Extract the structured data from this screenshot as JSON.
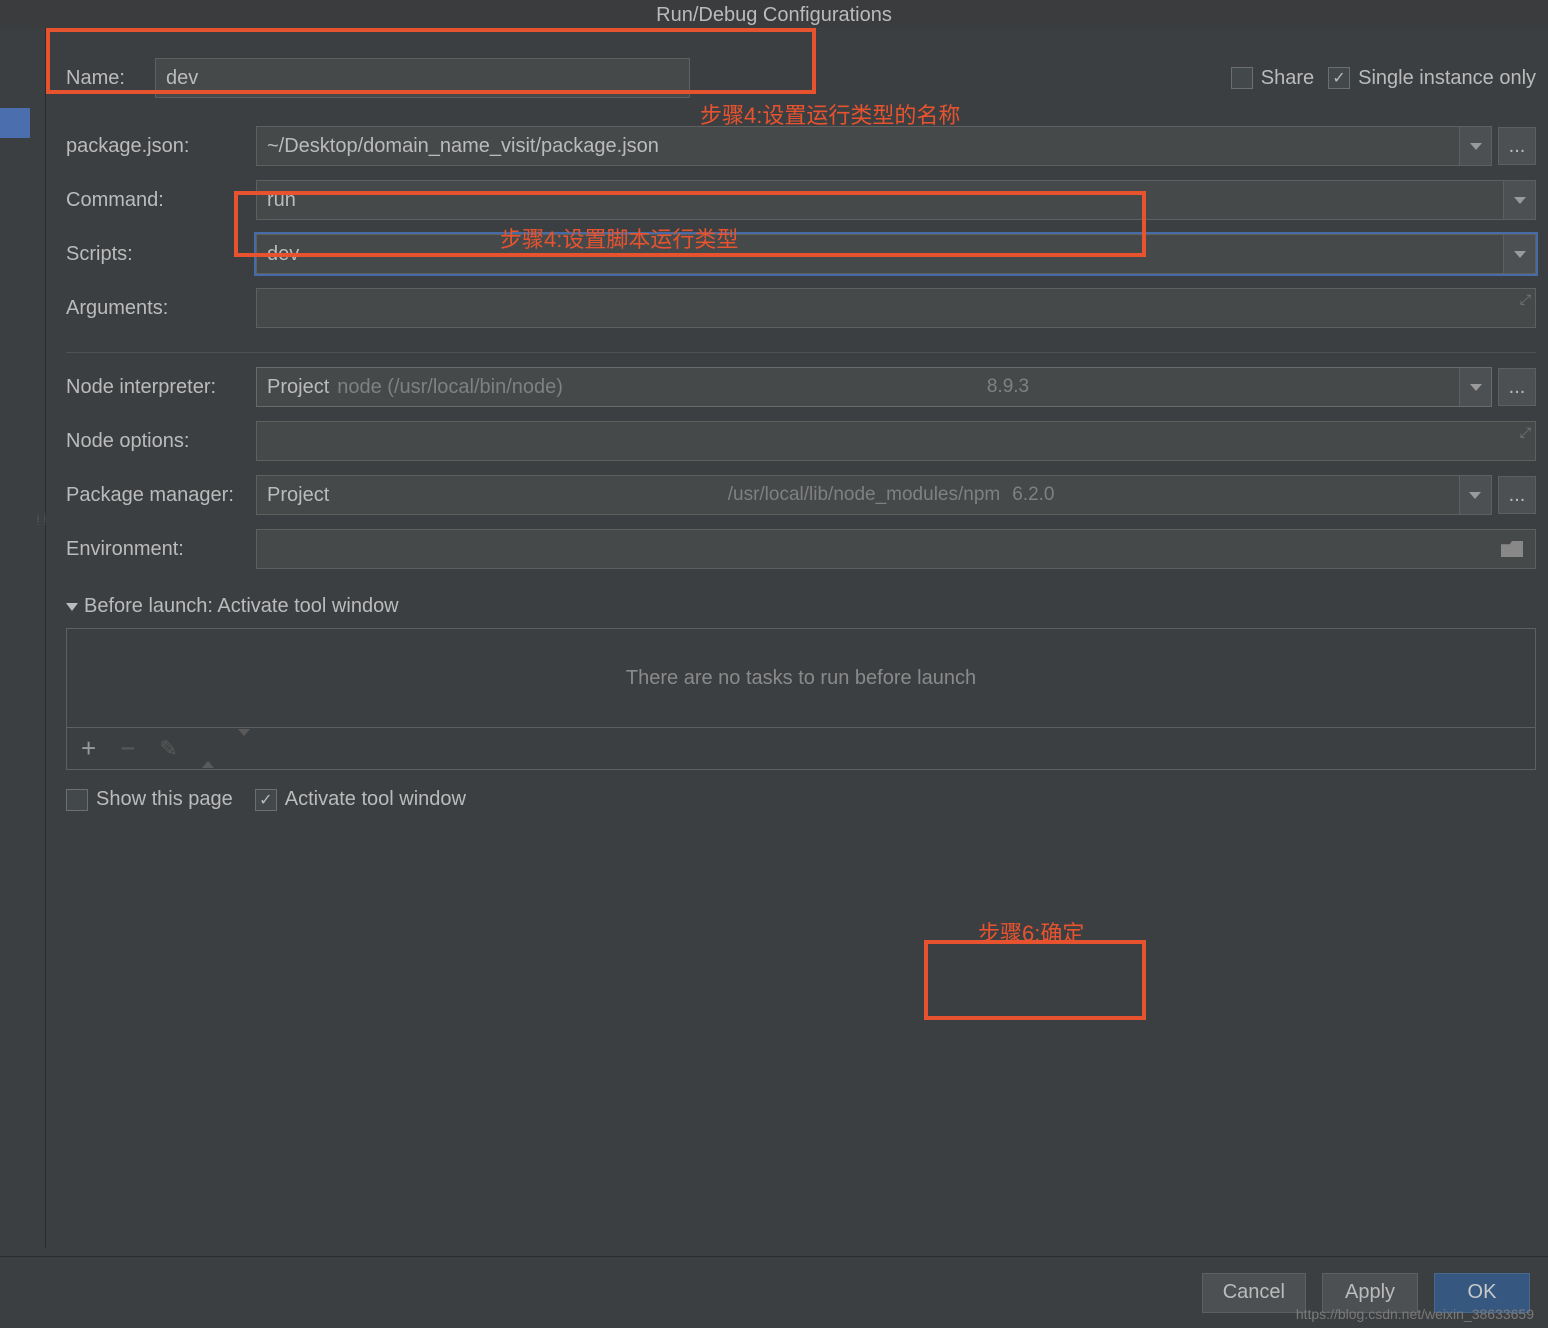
{
  "title": "Run/Debug Configurations",
  "form": {
    "name_label": "Name:",
    "name_value": "dev",
    "share_label": "Share",
    "single_instance_label": "Single instance only",
    "package_json_label": "package.json:",
    "package_json_value": "~/Desktop/domain_name_visit/package.json",
    "command_label": "Command:",
    "command_value": "run",
    "scripts_label": "Scripts:",
    "scripts_value": "dev",
    "arguments_label": "Arguments:",
    "node_interpreter_label": "Node interpreter:",
    "node_interpreter_prefix": "Project",
    "node_interpreter_path": "node (/usr/local/bin/node)",
    "node_interpreter_version": "8.9.3",
    "node_options_label": "Node options:",
    "package_manager_label": "Package manager:",
    "package_manager_prefix": "Project",
    "package_manager_path": "/usr/local/lib/node_modules/npm",
    "package_manager_version": "6.2.0",
    "environment_label": "Environment:",
    "before_launch_header": "Before launch: Activate tool window",
    "before_launch_empty": "There are no tasks to run before launch",
    "show_this_page": "Show this page",
    "activate_tool_window": "Activate tool window"
  },
  "buttons": {
    "cancel": "Cancel",
    "apply": "Apply",
    "ok": "OK"
  },
  "annotations": {
    "step4a": "步骤4:设置运行类型的名称",
    "step4b": "步骤4:设置脚本运行类型",
    "step6": "步骤6:确定"
  },
  "watermark": "https://blog.csdn.net/weixin_38633659"
}
